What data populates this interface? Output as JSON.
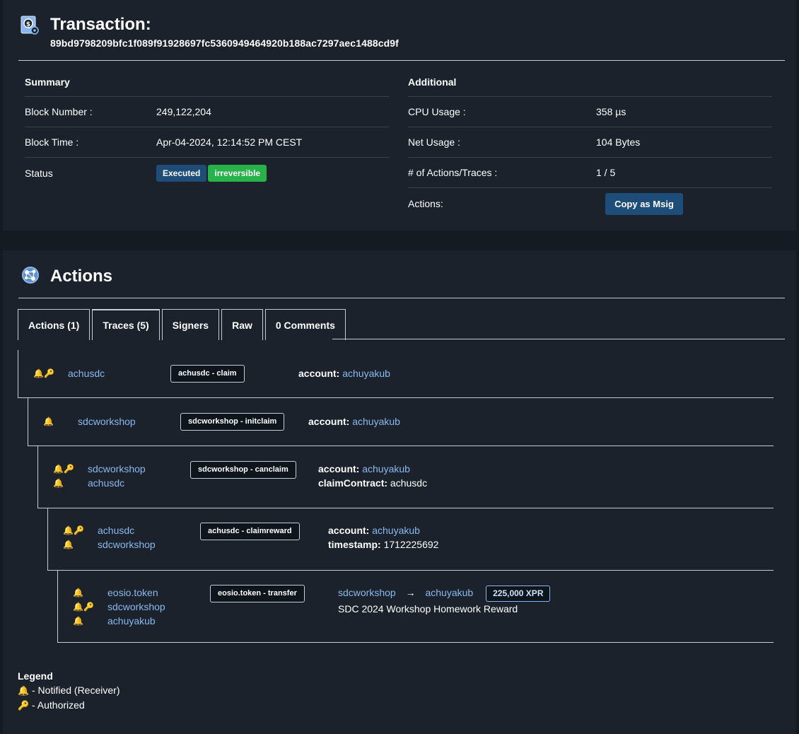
{
  "transaction": {
    "title": "Transaction:",
    "hash": "89bd9798209bfc1f089f91928697fc5360949464920b188ac7297aec1488cd9f"
  },
  "summary": {
    "heading": "Summary",
    "block_number_label": "Block Number :",
    "block_number": "249,122,204",
    "block_time_label": "Block Time :",
    "block_time": "Apr-04-2024, 12:14:52 PM CEST",
    "status_label": "Status",
    "status_executed": "Executed",
    "status_irreversible": "irreversible"
  },
  "additional": {
    "heading": "Additional",
    "cpu_label": "CPU Usage :",
    "cpu": "358 µs",
    "net_label": "Net Usage :",
    "net": "104 Bytes",
    "actions_traces_label": "# of Actions/Traces :",
    "actions_traces": "1 / 5",
    "actions_label": "Actions:",
    "copy_msig": "Copy as Msig"
  },
  "actions": {
    "title": "Actions",
    "tabs": [
      "Actions (1)",
      "Traces (5)",
      "Signers",
      "Raw",
      "0 Comments"
    ],
    "active_tab": 1
  },
  "traces": [
    {
      "accounts": [
        {
          "name": "achusdc",
          "notified": true,
          "authorized": true
        }
      ],
      "tag": "achusdc - claim",
      "fields": [
        {
          "key": "account:",
          "value": "achuyakub",
          "link": true
        }
      ]
    },
    {
      "accounts": [
        {
          "name": "sdcworkshop",
          "notified": true,
          "authorized": false
        }
      ],
      "tag": "sdcworkshop - initclaim",
      "fields": [
        {
          "key": "account:",
          "value": "achuyakub",
          "link": true
        }
      ]
    },
    {
      "accounts": [
        {
          "name": "sdcworkshop",
          "notified": true,
          "authorized": true
        },
        {
          "name": "achusdc",
          "notified": true,
          "authorized": false
        }
      ],
      "tag": "sdcworkshop - canclaim",
      "fields": [
        {
          "key": "account:",
          "value": "achuyakub",
          "link": true
        },
        {
          "key": "claimContract:",
          "value": "achusdc",
          "link": false
        }
      ]
    },
    {
      "accounts": [
        {
          "name": "achusdc",
          "notified": true,
          "authorized": true
        },
        {
          "name": "sdcworkshop",
          "notified": true,
          "authorized": false
        }
      ],
      "tag": "achusdc - claimreward",
      "fields": [
        {
          "key": "account:",
          "value": "achuyakub",
          "link": true
        },
        {
          "key": "timestamp:",
          "value": "1712225692",
          "link": false
        }
      ]
    },
    {
      "accounts": [
        {
          "name": "eosio.token",
          "notified": true,
          "authorized": false
        },
        {
          "name": "sdcworkshop",
          "notified": true,
          "authorized": true
        },
        {
          "name": "achuyakub",
          "notified": true,
          "authorized": false
        }
      ],
      "tag": "eosio.token - transfer",
      "transfer": {
        "from": "sdcworkshop",
        "arrow": "→",
        "to": "achuyakub",
        "quantity": "225,000 XPR",
        "memo": "SDC 2024 Workshop Homework Reward"
      }
    }
  ],
  "legend": {
    "title": "Legend",
    "notified": "- Notified (Receiver)",
    "authorized": "- Authorized"
  },
  "colors": {
    "background": "#151b22",
    "card": "#1b222b",
    "link": "#8ab8f0",
    "executed": "#1d4d78",
    "irreversible": "#27b24a"
  },
  "icons": {
    "bell": "bell-icon",
    "key": "key-icon",
    "transaction": "transaction-receipt-icon",
    "actions": "actions-network-icon"
  }
}
